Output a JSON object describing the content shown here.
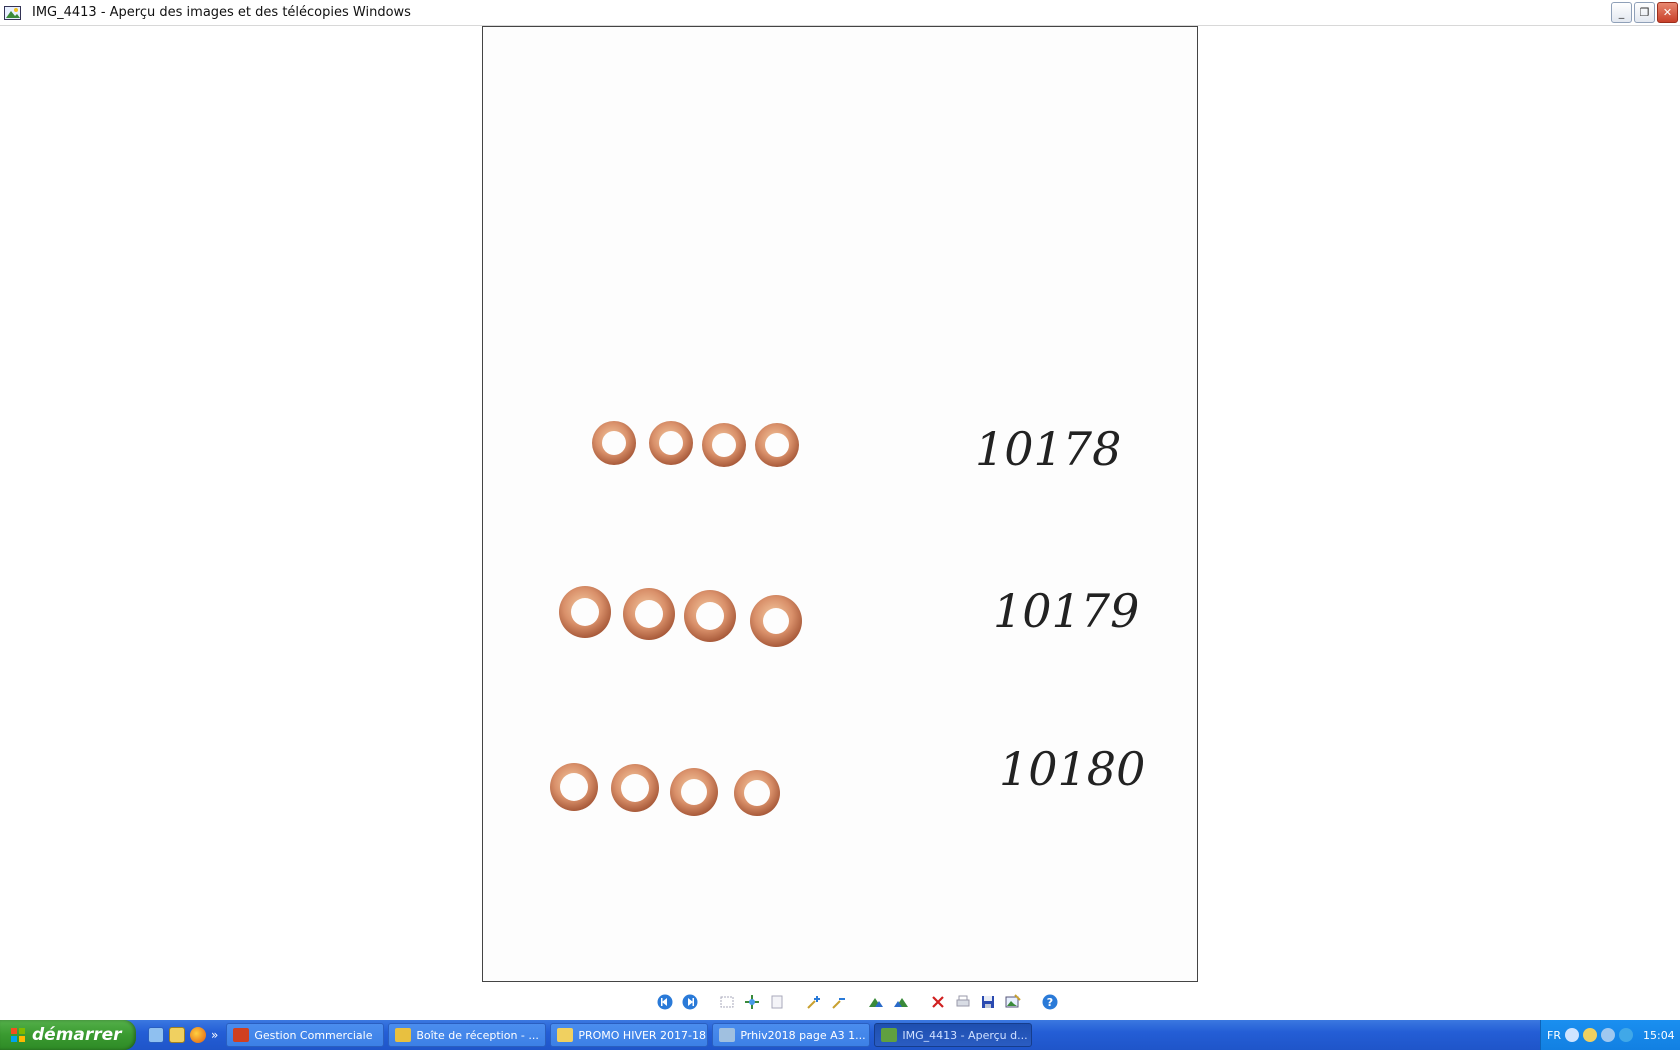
{
  "window": {
    "title": "IMG_4413 - Aperçu des images et des télécopies Windows",
    "controls": {
      "minimize": "_",
      "restore": "❐",
      "close": "✕"
    }
  },
  "photo": {
    "handwritten_labels": [
      "10178",
      "10179",
      "10180"
    ],
    "rows_of_washers": 3,
    "washers_per_row": 4
  },
  "viewer_toolbar": {
    "buttons": [
      "previous-icon",
      "next-icon",
      "best-fit-icon",
      "actual-size-icon",
      "slideshow-icon",
      "zoom-in-icon",
      "zoom-out-icon",
      "rotate-clockwise-icon",
      "rotate-counterclockwise-icon",
      "delete-icon",
      "print-icon",
      "save-icon",
      "open-editor-icon",
      "help-icon"
    ]
  },
  "taskbar": {
    "start_label": "démarrer",
    "tasks": [
      {
        "label": "Gestion Commerciale",
        "icon": "app-icon",
        "color": "#d04020"
      },
      {
        "label": "Boîte de réception - ...",
        "icon": "mail-icon",
        "color": "#e8c040"
      },
      {
        "label": "PROMO HIVER 2017-18",
        "icon": "folder-icon",
        "color": "#f0d060"
      },
      {
        "label": "Prhiv2018 page A3 1...",
        "icon": "image-icon",
        "color": "#a0c0e0"
      },
      {
        "label": "IMG_4413 - Aperçu d...",
        "icon": "image-viewer-icon",
        "color": "#60a040"
      }
    ],
    "tray": {
      "language": "FR",
      "clock": "15:04"
    }
  }
}
